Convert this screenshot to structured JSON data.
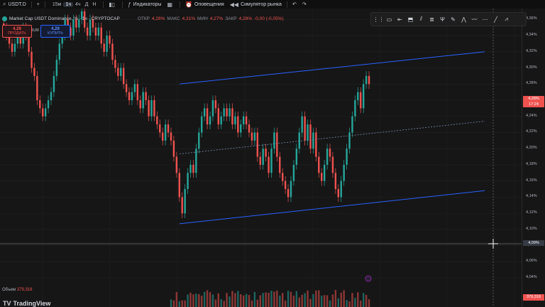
{
  "topbar": {
    "symbol": "USDT.D",
    "add_symbol": "+",
    "timeframes": [
      "15м",
      "1ч",
      "4ч",
      "Д",
      "Н"
    ],
    "active_timeframe": "1ч",
    "chart_type_icon": "candles-icon",
    "indicators_label": "Индикаторы",
    "templates_icon": "grid-icon",
    "alerts_label": "Оповещения",
    "replay_label": "Симулятор рынка",
    "undo": "↶",
    "redo": "↷"
  },
  "legend": {
    "title": "Market Cap USDT Dominance, % · 1ч · CRYPTOCAP",
    "open_label": "ОТКР",
    "open_value": "4,28%",
    "high_label": "МАКС",
    "high_value": "4,31%",
    "low_label": "МИН",
    "low_value": "4,27%",
    "close_label": "ЗАКР",
    "close_value": "4,28%",
    "change_value": "-0,00 (-0,05%)"
  },
  "trade": {
    "sell_price": "4,28",
    "sell_label": "ПРОДАТЬ",
    "spread": "0,00",
    "buy_price": "4,28",
    "buy_label": "КУПИТЬ"
  },
  "price_axis": {
    "ticks": [
      "4,36%",
      "4,34%",
      "4,32%",
      "4,30%",
      "4,28%",
      "4,26%",
      "4,24%",
      "4,22%",
      "4,20%",
      "4,18%",
      "4,16%",
      "4,14%",
      "4,12%",
      "4,10%",
      "4,08%",
      "4,06%",
      "4,04%"
    ],
    "top_label": "4,36%",
    "current_price": "4,28%",
    "current_time": "17:24",
    "cursor_price": "4,09%"
  },
  "volume": {
    "label": "Объем",
    "value": "379,318",
    "tag": "379,318"
  },
  "brand": {
    "name": "TradingView",
    "logo_text": "TV"
  },
  "colors": {
    "up": "#26a69a",
    "down": "#ef5350",
    "channel": "#2962ff",
    "background": "#161616",
    "grid": "#222222"
  },
  "chart_data": {
    "type": "candlestick",
    "symbol": "USDT.D",
    "ylim": [
      4.03,
      4.37
    ],
    "closes": [
      4.35,
      4.34,
      4.33,
      4.32,
      4.33,
      4.34,
      4.33,
      4.35,
      4.34,
      4.32,
      4.3,
      4.29,
      4.26,
      4.25,
      4.24,
      4.25,
      4.26,
      4.27,
      4.29,
      4.31,
      4.33,
      4.34,
      4.36,
      4.35,
      4.34,
      4.36,
      4.35,
      4.36,
      4.37,
      4.35,
      4.34,
      4.36,
      4.35,
      4.34,
      4.35,
      4.33,
      4.32,
      4.34,
      4.33,
      4.31,
      4.3,
      4.29,
      4.3,
      4.28,
      4.27,
      4.26,
      4.27,
      4.28,
      4.26,
      4.25,
      4.27,
      4.26,
      4.24,
      4.26,
      4.24,
      4.23,
      4.22,
      4.21,
      4.23,
      4.22,
      4.21,
      4.19,
      4.17,
      4.14,
      4.12,
      4.15,
      4.17,
      4.18,
      4.17,
      4.2,
      4.22,
      4.24,
      4.25,
      4.23,
      4.24,
      4.26,
      4.25,
      4.23,
      4.24,
      4.25,
      4.24,
      4.25,
      4.23,
      4.24,
      4.22,
      4.23,
      4.24,
      4.23,
      4.22,
      4.21,
      4.22,
      4.19,
      4.18,
      4.2,
      4.19,
      4.17,
      4.2,
      4.22,
      4.19,
      4.17,
      4.16,
      4.15,
      4.14,
      4.16,
      4.18,
      4.2,
      4.22,
      4.24,
      4.21,
      4.23,
      4.2,
      4.22,
      4.19,
      4.17,
      4.16,
      4.18,
      4.2,
      4.19,
      4.17,
      4.15,
      4.14,
      4.16,
      4.18,
      4.2,
      4.22,
      4.24,
      4.26,
      4.27,
      4.25,
      4.28,
      4.29,
      4.28
    ],
    "channel": {
      "upper": {
        "start": [
          0,
          4.28
        ],
        "end": [
          1,
          4.32
        ]
      },
      "lower": {
        "start": [
          0,
          4.107
        ],
        "end": [
          1,
          4.148
        ]
      }
    }
  }
}
